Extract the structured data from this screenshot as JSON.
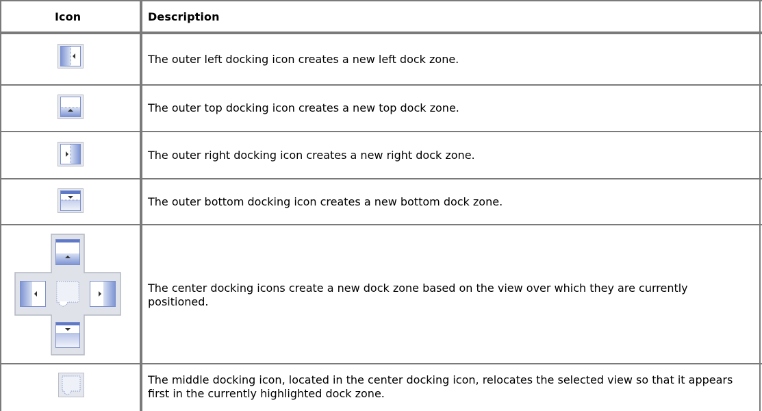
{
  "table": {
    "headers": {
      "icon": "Icon",
      "description": "Description"
    },
    "rows": [
      {
        "icon": "outer-left-dock-icon",
        "description": "The outer left docking icon creates a new left dock zone."
      },
      {
        "icon": "outer-top-dock-icon",
        "description": "The outer top docking icon creates a new top dock zone."
      },
      {
        "icon": "outer-right-dock-icon",
        "description": "The outer right docking icon creates a new right dock zone."
      },
      {
        "icon": "outer-bottom-dock-icon",
        "description": "The outer bottom docking icon creates a new bottom dock zone."
      },
      {
        "icon": "center-dock-icons",
        "description": "The center docking icons create a new dock zone based on the view over which they are currently positioned."
      },
      {
        "icon": "middle-dock-icon",
        "description": "The middle docking icon, located in the center docking icon, relocates the selected view so that it appears first in the currently highlighted dock zone."
      }
    ]
  }
}
